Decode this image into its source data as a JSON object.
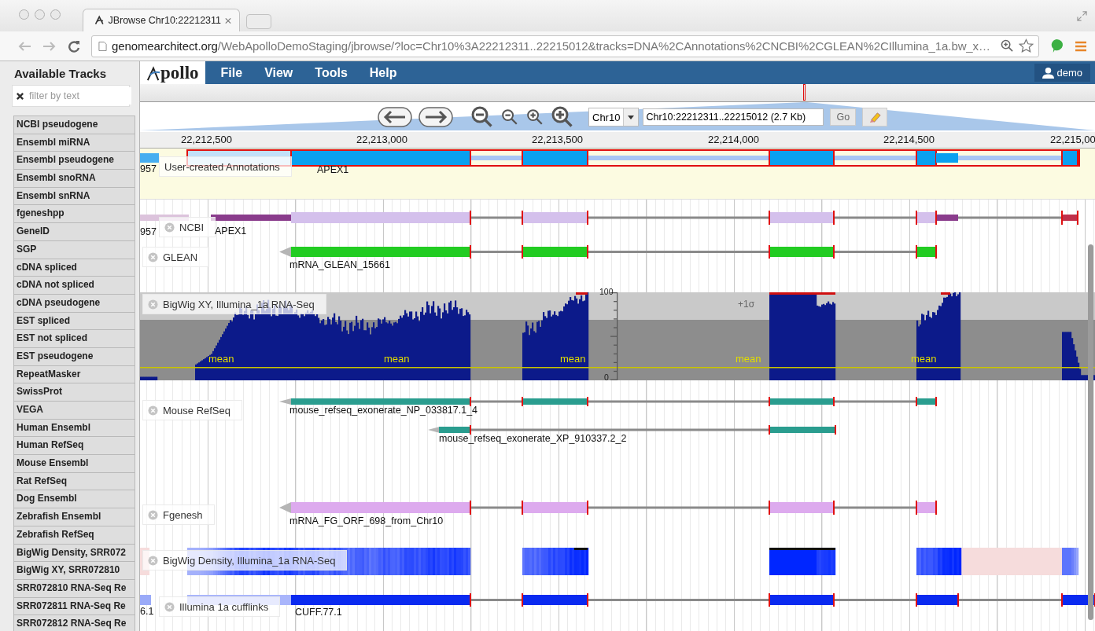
{
  "browser": {
    "tab_title": "JBrowse Chr10:22212311",
    "url_host": "genomearchitect.org",
    "url_path": "/WebApolloDemoStaging/jbrowse/?loc=Chr10%3A22212311..22215012&tracks=DNA%2CAnnotations%2CNCBI%2CGLEAN%2CIllumina_1a.bw_x…"
  },
  "sidebar": {
    "title": "Available Tracks",
    "filter": {
      "placeholder": "filter by text"
    },
    "items": [
      "NCBI pseudogene",
      "Ensembl miRNA",
      "Ensembl pseudogene",
      "Ensembl snoRNA",
      "Ensembl snRNA",
      "fgeneshpp",
      "GeneID",
      "SGP",
      "cDNA spliced",
      "cDNA not spliced",
      "cDNA pseudogene",
      "EST spliced",
      "EST not spliced",
      "EST pseudogene",
      "RepeatMasker",
      "SwissProt",
      "VEGA",
      "Human Ensembl",
      "Human RefSeq",
      "Mouse Ensembl",
      "Rat RefSeq",
      "Dog Ensembl",
      "Zebrafish Ensembl",
      "Zebrafish RefSeq",
      "BigWig Density, SRR072",
      "BigWig XY, SRR072810",
      "SRR072810 RNA-Seq Re",
      "SRR072811 RNA-Seq Re",
      "SRR072812 RNA-Seq Re"
    ]
  },
  "menubar": {
    "logo": "pollo",
    "menus": [
      "File",
      "View",
      "Tools",
      "Help"
    ],
    "user": "demo"
  },
  "navigation": {
    "chromosome": "Chr10",
    "location": "Chr10:22212311..22215012 (2.7 Kb)",
    "go": "Go"
  },
  "ruler": [
    "22,212,500",
    "22,213,000",
    "22,213,500",
    "22,214,000",
    "22,214,500",
    "22,215,00"
  ],
  "tracks": [
    {
      "kind": "annotation",
      "label": "User-created Annotations",
      "features": [
        {
          "name": "957"
        },
        {
          "name": "APEX1"
        }
      ]
    },
    {
      "kind": "gene",
      "label": "NCBI",
      "color": "#d4c0ec",
      "features": [
        {
          "name": "957"
        },
        {
          "name": "APEX1"
        }
      ]
    },
    {
      "kind": "gene",
      "label": "GLEAN",
      "color": "#22cc22",
      "features": [
        {
          "name": "mRNA_GLEAN_15661"
        }
      ]
    },
    {
      "kind": "xy",
      "label": "BigWig XY, Illumina_1a RNA-Seq",
      "axis_labels": [
        "100",
        "0"
      ],
      "mean_labels": [
        "mean",
        "mean",
        "mean",
        "mean",
        "mean"
      ],
      "sigma_labels": [
        "+1σ"
      ]
    },
    {
      "kind": "gene",
      "label": "Mouse RefSeq",
      "color": "#2a9d8f",
      "features": [
        {
          "name": "mouse_refseq_exonerate_NP_033817.1_4"
        },
        {
          "name": "mouse_refseq_exonerate_XP_910337.2_2"
        }
      ]
    },
    {
      "kind": "gene",
      "label": "Fgenesh",
      "color": "#ddaaee",
      "features": [
        {
          "name": "mRNA_FG_ORF_698_from_Chr10"
        }
      ]
    },
    {
      "kind": "density",
      "label": "BigWig Density, Illumina_1a RNA-Seq"
    },
    {
      "kind": "gene",
      "label": "Illumina 1a cufflinks",
      "color": "#0a2af0",
      "features": [
        {
          "name": "6.1"
        },
        {
          "name": "CUFF.77.1"
        }
      ]
    }
  ]
}
